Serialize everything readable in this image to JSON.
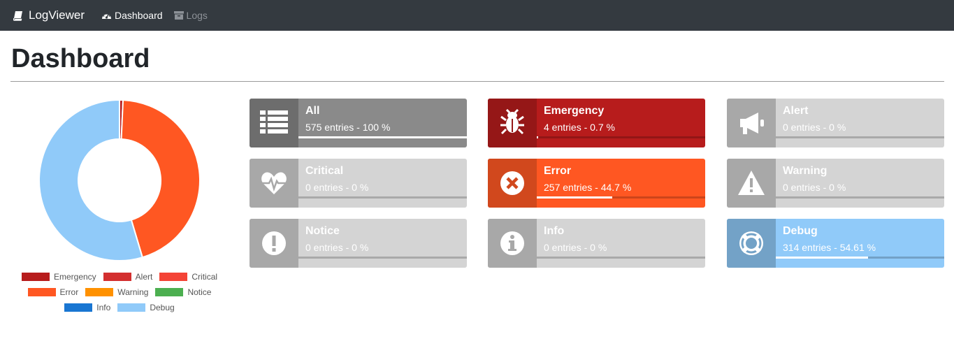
{
  "navbar": {
    "brand": "LogViewer",
    "links": [
      {
        "label": "Dashboard",
        "icon": "dashboard-icon",
        "active": true
      },
      {
        "label": "Logs",
        "icon": "archive-icon",
        "active": false
      }
    ]
  },
  "page": {
    "title": "Dashboard"
  },
  "chart_data": {
    "type": "pie",
    "series": [
      {
        "name": "Emergency",
        "value": 4,
        "color": "#b71c1c"
      },
      {
        "name": "Alert",
        "value": 0,
        "color": "#d32f2f"
      },
      {
        "name": "Critical",
        "value": 0,
        "color": "#f44336"
      },
      {
        "name": "Error",
        "value": 257,
        "color": "#ff5722"
      },
      {
        "name": "Warning",
        "value": 0,
        "color": "#ff9100"
      },
      {
        "name": "Notice",
        "value": 0,
        "color": "#4caf50"
      },
      {
        "name": "Info",
        "value": 0,
        "color": "#1976d2"
      },
      {
        "name": "Debug",
        "value": 314,
        "color": "#90caf9"
      }
    ],
    "legend": "bottom"
  },
  "cards": [
    {
      "level": "All",
      "entries": "575 entries - 100 %",
      "percent": 100,
      "icon": "list-icon",
      "active": true,
      "color": "#8a8a8a",
      "icon_bg": "#6d6d6d"
    },
    {
      "level": "Emergency",
      "entries": "4 entries - 0.7 %",
      "percent": 0.7,
      "icon": "bug-icon",
      "active": true,
      "color": "#b71c1c",
      "icon_bg": "#951717"
    },
    {
      "level": "Alert",
      "entries": "0 entries - 0 %",
      "percent": 0,
      "icon": "bullhorn-icon",
      "active": false,
      "color": "#d4d4d4",
      "icon_bg": "#a8a8a8"
    },
    {
      "level": "Critical",
      "entries": "0 entries - 0 %",
      "percent": 0,
      "icon": "heartbeat-icon",
      "active": false,
      "color": "#d4d4d4",
      "icon_bg": "#a8a8a8"
    },
    {
      "level": "Error",
      "entries": "257 entries - 44.7 %",
      "percent": 44.7,
      "icon": "times-circle-icon",
      "active": true,
      "color": "#ff5722",
      "icon_bg": "#d1481d"
    },
    {
      "level": "Warning",
      "entries": "0 entries - 0 %",
      "percent": 0,
      "icon": "exclamation-triangle-icon",
      "active": false,
      "color": "#d4d4d4",
      "icon_bg": "#a8a8a8"
    },
    {
      "level": "Notice",
      "entries": "0 entries - 0 %",
      "percent": 0,
      "icon": "exclamation-circle-icon",
      "active": false,
      "color": "#d4d4d4",
      "icon_bg": "#a8a8a8"
    },
    {
      "level": "Info",
      "entries": "0 entries - 0 %",
      "percent": 0,
      "icon": "info-circle-icon",
      "active": false,
      "color": "#d4d4d4",
      "icon_bg": "#a8a8a8"
    },
    {
      "level": "Debug",
      "entries": "314 entries - 54.61 %",
      "percent": 54.61,
      "icon": "life-ring-icon",
      "active": true,
      "color": "#90caf9",
      "icon_bg": "#73a2c7"
    }
  ]
}
